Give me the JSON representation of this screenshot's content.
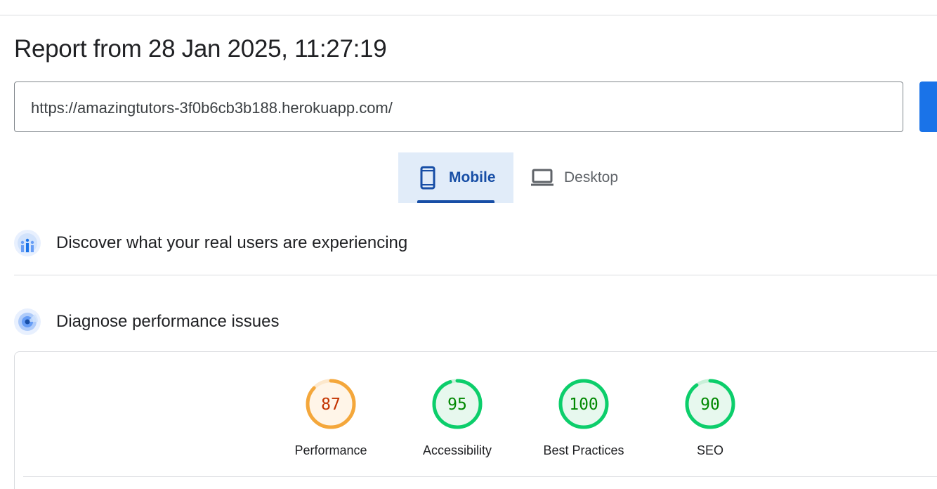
{
  "report": {
    "title": "Report from 28 Jan 2025, 11:27:19"
  },
  "url_input": {
    "value": "https://amazingtutors-3f0b6cb3b188.herokuapp.com/"
  },
  "device_tabs": [
    {
      "label": "Mobile",
      "icon": "smartphone-icon",
      "selected": true
    },
    {
      "label": "Desktop",
      "icon": "laptop-icon",
      "selected": false
    }
  ],
  "sections": {
    "crux": {
      "title": "Discover what your real users are experiencing",
      "icon": "users-chart-icon"
    },
    "diagnose": {
      "title": "Diagnose performance issues",
      "icon": "lighthouse-radar-icon"
    }
  },
  "scores": [
    {
      "label": "Performance",
      "value": 87,
      "status": "average"
    },
    {
      "label": "Accessibility",
      "value": 95,
      "status": "pass"
    },
    {
      "label": "Best Practices",
      "value": 100,
      "status": "pass"
    },
    {
      "label": "SEO",
      "value": 90,
      "status": "pass"
    }
  ],
  "colors": {
    "average_ring": "#f4a73b",
    "average_fill": "#fff5e8",
    "average_text": "#c33300",
    "pass_ring": "#0cce6b",
    "pass_fill": "#e7f8ee",
    "pass_text": "#008800",
    "accent": "#1a73e8",
    "tab_selected": "#174ea6"
  }
}
